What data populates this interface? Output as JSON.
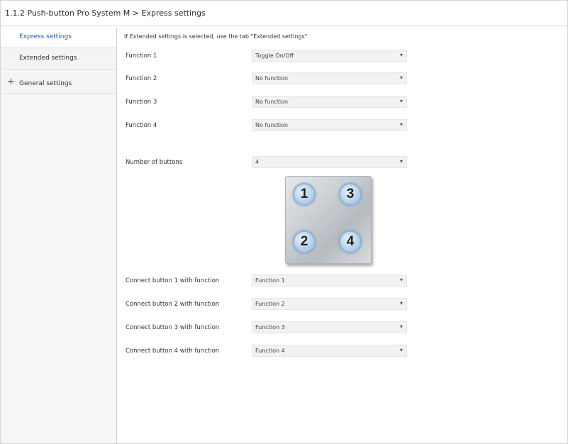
{
  "window": {
    "title": "1.1.2 Push-button Pro System M > Express settings"
  },
  "sidebar": {
    "items": [
      {
        "label": "Express settings"
      },
      {
        "label": "Extended settings"
      },
      {
        "label": "General settings",
        "expander": "+"
      }
    ]
  },
  "main": {
    "info_text": "If Extended settings is selected, use the tab \"Extended settings\"",
    "dropdown_arrow": "▾",
    "functions": [
      {
        "label": "Function 1",
        "value": "Toggle On/Off"
      },
      {
        "label": "Function 2",
        "value": "No function"
      },
      {
        "label": "Function 3",
        "value": "No function"
      },
      {
        "label": "Function 4",
        "value": "No function"
      }
    ],
    "number_of_buttons": {
      "label": "Number of buttons",
      "value": "4"
    },
    "panel_buttons": [
      "1",
      "3",
      "2",
      "4"
    ],
    "connections": [
      {
        "label": "Connect button 1 with function",
        "value": "Function 1"
      },
      {
        "label": "Connect button 2 with function",
        "value": "Function 2"
      },
      {
        "label": "Connect button 3 with function",
        "value": "Function 3"
      },
      {
        "label": "Connect button 4 with function",
        "value": "Function 4"
      }
    ]
  },
  "colors": {
    "accent_link": "#1a56a8",
    "panel_button_ring": "#8fb4d9"
  }
}
